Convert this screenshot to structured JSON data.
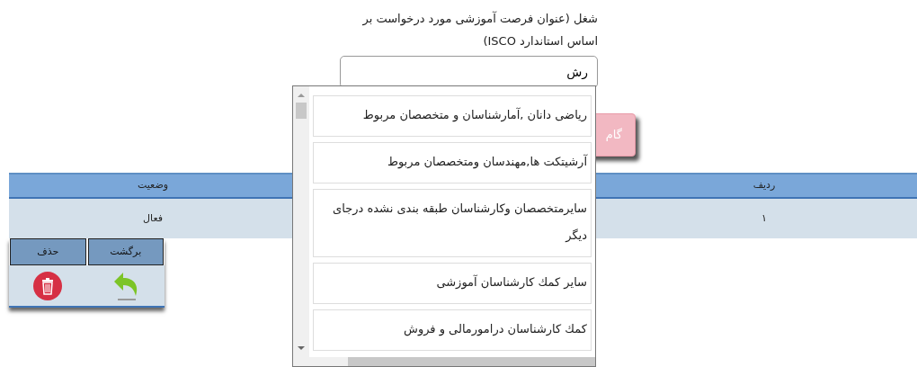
{
  "field": {
    "label": "شغل (عنوان فرصت آموزشی مورد درخواست بر اساس استاندارد ISCO)",
    "value": "رش"
  },
  "buttons": [
    {
      "label": "گام",
      "kind": "prev"
    }
  ],
  "table": {
    "columns": [
      "ردیف",
      "وضعیت"
    ],
    "rows": [
      [
        "۱",
        "فعال"
      ]
    ]
  },
  "actions": [
    {
      "label": "برگشت",
      "kind": "back"
    },
    {
      "label": "حذف",
      "kind": "delete"
    }
  ],
  "suggestions": [
    "ریاضی دانان ,آمارشناسان و متخصصان مربوط",
    "آرشیتکت ها,مهندسان ومتخصصان مربوط",
    "سایرمتخصصان وکارشناسان طبقه بندی نشده درجای دیگر",
    "سایر کمك کارشناسان آموزشی",
    "کمك کارشناسان درامورمالی و فروش"
  ]
}
